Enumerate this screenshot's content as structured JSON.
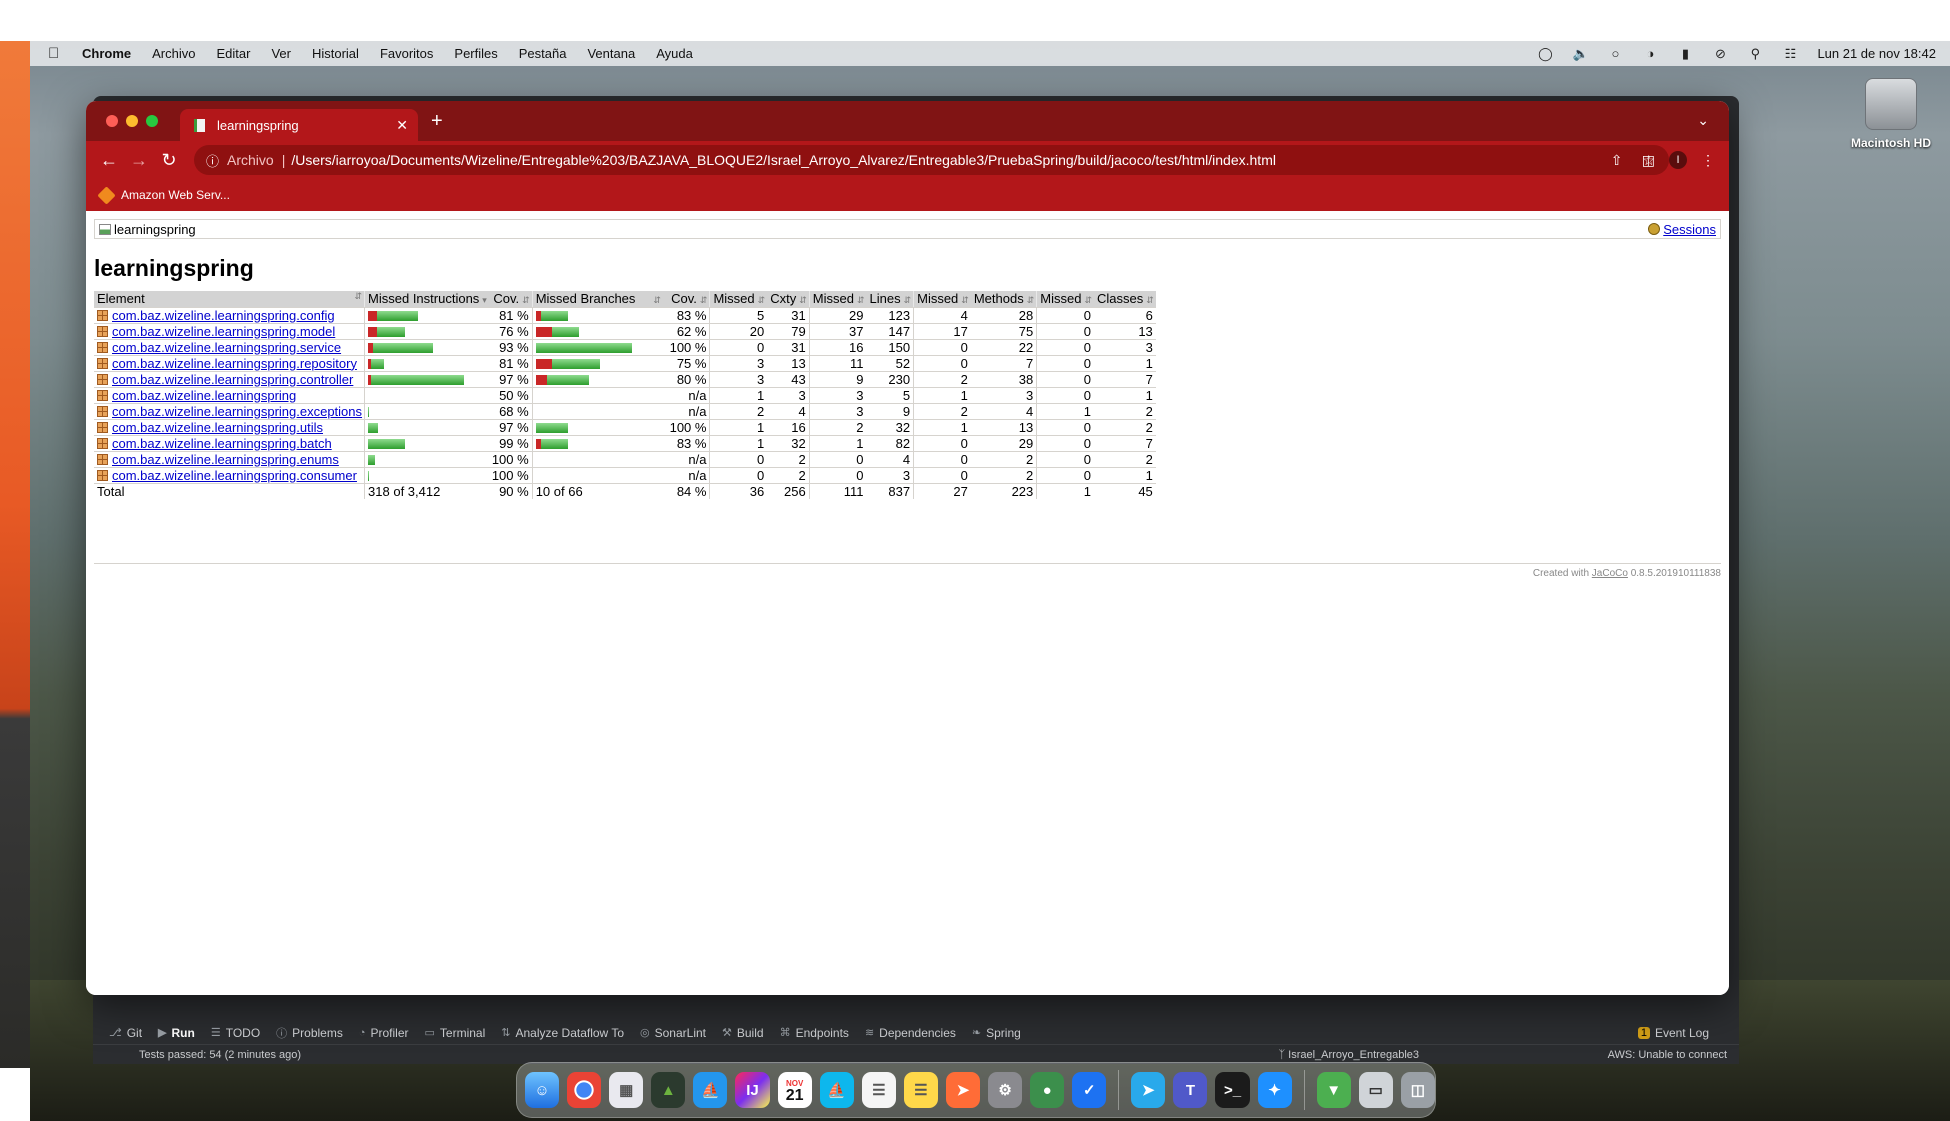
{
  "menubar": {
    "app_name": "Chrome",
    "items": [
      "Archivo",
      "Editar",
      "Ver",
      "Historial",
      "Favoritos",
      "Perfiles",
      "Pestaña",
      "Ventana",
      "Ayuda"
    ],
    "clock": "Lun 21 de nov  18:42"
  },
  "desktop": {
    "disk_label": "Macintosh HD"
  },
  "chrome": {
    "tab_title": "learningspring",
    "omnibox": {
      "scheme_label": "Archivo",
      "url": "/Users/iarroyoa/Documents/Wizeline/Entregable%203/BAZJAVA_BLOQUE2/Israel_Arroyo_Alvarez/Entregable3/PruebaSpring/build/jacoco/test/html/index.html"
    },
    "profile_initial": "I",
    "bookmarks": [
      {
        "label": "Amazon Web Serv..."
      }
    ]
  },
  "report": {
    "breadcrumb": "learningspring",
    "sessions_link": "Sessions",
    "title": "learningspring",
    "columns": [
      "Element",
      "Missed Instructions",
      "Cov.",
      "Missed Branches",
      "Cov.",
      "Missed",
      "Cxty",
      "Missed",
      "Lines",
      "Missed",
      "Methods",
      "Missed",
      "Classes"
    ],
    "rows": [
      {
        "element": "com.baz.wizeline.learningspring.config",
        "instr_cov_ratio": 0.81,
        "instr_bar_scale": 0.52,
        "instr_cov": "81 %",
        "branch_cov_ratio": 0.83,
        "branch_bar_scale": 0.33,
        "branch_cov": "83 %",
        "missed_cxty": "5",
        "cxty": "31",
        "missed_lines": "29",
        "lines": "123",
        "missed_methods": "4",
        "methods": "28",
        "missed_classes": "0",
        "classes": "6"
      },
      {
        "element": "com.baz.wizeline.learningspring.model",
        "instr_cov_ratio": 0.76,
        "instr_bar_scale": 0.39,
        "instr_cov": "76 %",
        "branch_cov_ratio": 0.62,
        "branch_bar_scale": 0.45,
        "branch_cov": "62 %",
        "missed_cxty": "20",
        "cxty": "79",
        "missed_lines": "37",
        "lines": "147",
        "missed_methods": "17",
        "methods": "75",
        "missed_classes": "0",
        "classes": "13"
      },
      {
        "element": "com.baz.wizeline.learningspring.service",
        "instr_cov_ratio": 0.93,
        "instr_bar_scale": 0.68,
        "instr_cov": "93 %",
        "branch_cov_ratio": 1.0,
        "branch_bar_scale": 1.0,
        "branch_cov": "100 %",
        "missed_cxty": "0",
        "cxty": "31",
        "missed_lines": "16",
        "lines": "150",
        "missed_methods": "0",
        "methods": "22",
        "missed_classes": "0",
        "classes": "3"
      },
      {
        "element": "com.baz.wizeline.learningspring.repository",
        "instr_cov_ratio": 0.81,
        "instr_bar_scale": 0.17,
        "instr_cov": "81 %",
        "branch_cov_ratio": 0.75,
        "branch_bar_scale": 0.67,
        "branch_cov": "75 %",
        "missed_cxty": "3",
        "cxty": "13",
        "missed_lines": "11",
        "lines": "52",
        "missed_methods": "0",
        "methods": "7",
        "missed_classes": "0",
        "classes": "1"
      },
      {
        "element": "com.baz.wizeline.learningspring.controller",
        "instr_cov_ratio": 0.97,
        "instr_bar_scale": 1.0,
        "instr_cov": "97 %",
        "branch_cov_ratio": 0.8,
        "branch_bar_scale": 0.55,
        "branch_cov": "80 %",
        "missed_cxty": "3",
        "cxty": "43",
        "missed_lines": "9",
        "lines": "230",
        "missed_methods": "2",
        "methods": "38",
        "missed_classes": "0",
        "classes": "7"
      },
      {
        "element": "com.baz.wizeline.learningspring",
        "instr_cov_ratio": 0.5,
        "instr_bar_scale": 0.0,
        "instr_cov": "50 %",
        "branch_cov_ratio": null,
        "branch_bar_scale": 0.0,
        "branch_cov": "n/a",
        "missed_cxty": "1",
        "cxty": "3",
        "missed_lines": "3",
        "lines": "5",
        "missed_methods": "1",
        "methods": "3",
        "missed_classes": "0",
        "classes": "1"
      },
      {
        "element": "com.baz.wizeline.learningspring.exceptions",
        "instr_cov_ratio": 0.68,
        "instr_bar_scale": 0.01,
        "instr_cov": "68 %",
        "branch_cov_ratio": null,
        "branch_bar_scale": 0.0,
        "branch_cov": "n/a",
        "missed_cxty": "2",
        "cxty": "4",
        "missed_lines": "3",
        "lines": "9",
        "missed_methods": "2",
        "methods": "4",
        "missed_classes": "1",
        "classes": "2"
      },
      {
        "element": "com.baz.wizeline.learningspring.utils",
        "instr_cov_ratio": 0.97,
        "instr_bar_scale": 0.1,
        "instr_cov": "97 %",
        "branch_cov_ratio": 1.0,
        "branch_bar_scale": 0.33,
        "branch_cov": "100 %",
        "missed_cxty": "1",
        "cxty": "16",
        "missed_lines": "2",
        "lines": "32",
        "missed_methods": "1",
        "methods": "13",
        "missed_classes": "0",
        "classes": "2"
      },
      {
        "element": "com.baz.wizeline.learningspring.batch",
        "instr_cov_ratio": 0.99,
        "instr_bar_scale": 0.39,
        "instr_cov": "99 %",
        "branch_cov_ratio": 0.83,
        "branch_bar_scale": 0.33,
        "branch_cov": "83 %",
        "missed_cxty": "1",
        "cxty": "32",
        "missed_lines": "1",
        "lines": "82",
        "missed_methods": "0",
        "methods": "29",
        "missed_classes": "0",
        "classes": "7"
      },
      {
        "element": "com.baz.wizeline.learningspring.enums",
        "instr_cov_ratio": 1.0,
        "instr_bar_scale": 0.07,
        "instr_cov": "100 %",
        "branch_cov_ratio": null,
        "branch_bar_scale": 0.0,
        "branch_cov": "n/a",
        "missed_cxty": "0",
        "cxty": "2",
        "missed_lines": "0",
        "lines": "4",
        "missed_methods": "0",
        "methods": "2",
        "missed_classes": "0",
        "classes": "2"
      },
      {
        "element": "com.baz.wizeline.learningspring.consumer",
        "instr_cov_ratio": 1.0,
        "instr_bar_scale": 0.01,
        "instr_cov": "100 %",
        "branch_cov_ratio": null,
        "branch_bar_scale": 0.0,
        "branch_cov": "n/a",
        "missed_cxty": "0",
        "cxty": "2",
        "missed_lines": "0",
        "lines": "3",
        "missed_methods": "0",
        "methods": "2",
        "missed_classes": "0",
        "classes": "1"
      }
    ],
    "total": {
      "label": "Total",
      "missed_instr": "318 of 3,412",
      "instr_cov": "90 %",
      "missed_branches": "10 of 66",
      "branch_cov": "84 %",
      "missed_cxty": "36",
      "cxty": "256",
      "missed_lines": "111",
      "lines": "837",
      "missed_methods": "27",
      "methods": "223",
      "missed_classes": "1",
      "classes": "45"
    },
    "footer_prefix": "Created with",
    "footer_link": "JaCoCo",
    "footer_version": "0.8.5.201910111838",
    "colors": {
      "missed": "#c92727",
      "covered": "#2e9e2e",
      "header_bg": "#d3d3d3",
      "link": "#0000cc"
    }
  },
  "ide": {
    "tool_windows": [
      {
        "icon": "git-icon",
        "glyph": "⎇",
        "label": "Git"
      },
      {
        "icon": "run-icon",
        "glyph": "▶",
        "label": "Run"
      },
      {
        "icon": "todo-icon",
        "glyph": "☰",
        "label": "TODO"
      },
      {
        "icon": "problems-icon",
        "glyph": "ⓘ",
        "label": "Problems"
      },
      {
        "icon": "profiler-icon",
        "glyph": "◔",
        "label": "Profiler"
      },
      {
        "icon": "terminal-icon",
        "glyph": "▭",
        "label": "Terminal"
      },
      {
        "icon": "dataflow-icon",
        "glyph": "⇅",
        "label": "Analyze Dataflow To"
      },
      {
        "icon": "sonarlint-icon",
        "glyph": "◎",
        "label": "SonarLint"
      },
      {
        "icon": "build-icon",
        "glyph": "⚒",
        "label": "Build"
      },
      {
        "icon": "endpoints-icon",
        "glyph": "⌘",
        "label": "Endpoints"
      },
      {
        "icon": "dependencies-icon",
        "glyph": "≋",
        "label": "Dependencies"
      },
      {
        "icon": "spring-icon",
        "glyph": "❧",
        "label": "Spring"
      }
    ],
    "event_log": "Event Log",
    "event_log_badge": "1",
    "status_text": "Tests passed: 54 (2 minutes ago)",
    "branch": "Israel_Arroyo_Entregable3",
    "aws_status": "AWS: Unable to connect"
  },
  "dock": {
    "calendar_month": "NOV",
    "calendar_day": "21"
  }
}
